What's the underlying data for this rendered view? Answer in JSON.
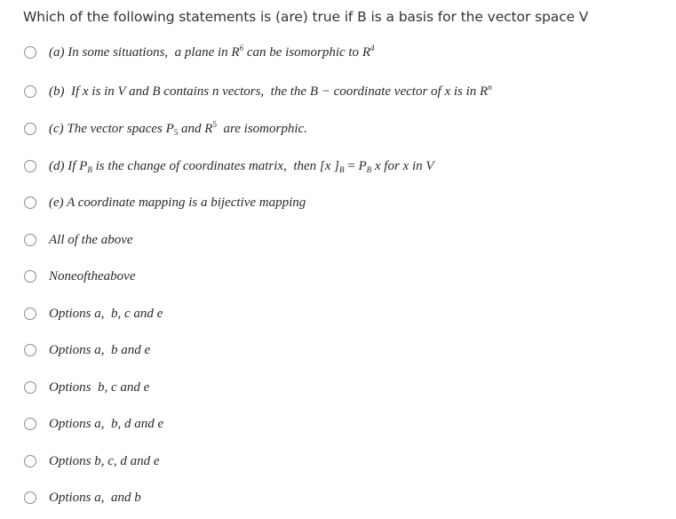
{
  "question": {
    "text": "Which of the following statements is (are) true if B is a basis for the vector space V"
  },
  "options": [
    {
      "id": "a",
      "parts": {
        "p1": "(a) In some situations,  a plane in ",
        "r1": "R",
        "sup1": "6",
        "p2": " can be isomorphic to ",
        "r2": "R",
        "sup2": "4"
      }
    },
    {
      "id": "b",
      "parts": {
        "p1": "(b)  If x is in V and B contains n vectors,  the the B − coordinate vector of x is in ",
        "r1": "R",
        "sup1": "n"
      }
    },
    {
      "id": "c",
      "parts": {
        "p1": "(c) The vector spaces ",
        "r1": "P",
        "sub1": "5",
        "p2": " and ",
        "r2": "R",
        "sup2": "5",
        "p3": "  are isomorphic."
      }
    },
    {
      "id": "d",
      "parts": {
        "p1": "(d) If ",
        "r1": "P",
        "sub1": "B",
        "p2": " is the change of coordinates matrix,  then [x ]",
        "sub2": "B",
        "p3": " = ",
        "r3": "P",
        "sub3": "B",
        "p4": " x for x in V"
      }
    },
    {
      "id": "e",
      "text": "(e) A coordinate mapping is a bijective mapping"
    },
    {
      "id": "all",
      "text": "All of the above"
    },
    {
      "id": "none",
      "text": "Noneoftheabove"
    },
    {
      "id": "abce",
      "text": "Options a,  b, c and e"
    },
    {
      "id": "abe",
      "text": "Options a,  b and e"
    },
    {
      "id": "bce",
      "text": "Options  b, c and e"
    },
    {
      "id": "abde",
      "text": "Options a,  b, d and e"
    },
    {
      "id": "bcde",
      "text": "Options b, c, d and e"
    },
    {
      "id": "ab",
      "text": "Options a,  and b"
    }
  ]
}
